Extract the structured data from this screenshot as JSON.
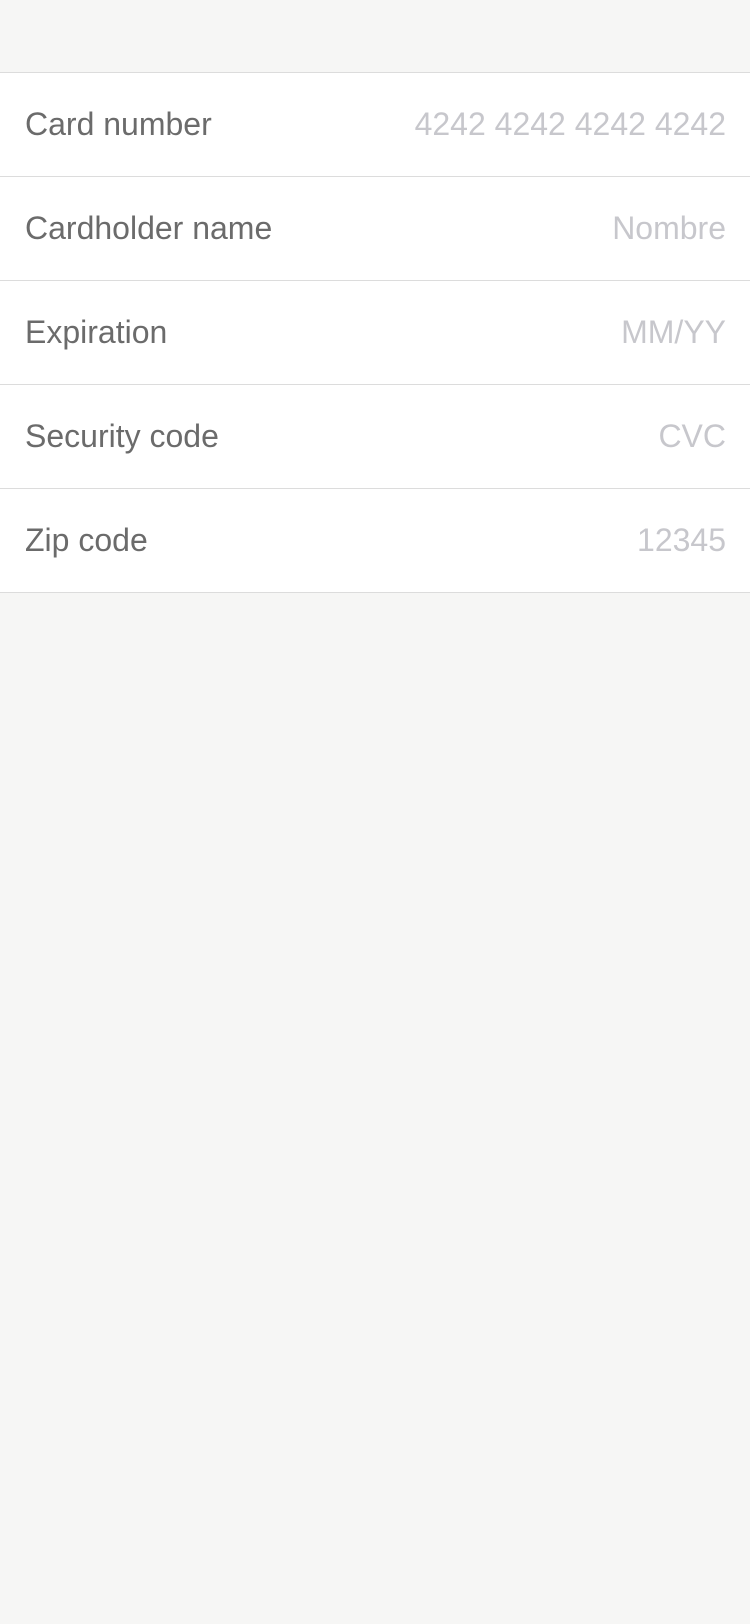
{
  "form": {
    "rows": [
      {
        "label": "Card number",
        "value": "",
        "placeholder": "4242 4242 4242 4242"
      },
      {
        "label": "Cardholder name",
        "value": "",
        "placeholder": "Nombre"
      },
      {
        "label": "Expiration",
        "value": "",
        "placeholder": "MM/YY"
      },
      {
        "label": "Security code",
        "value": "",
        "placeholder": "CVC"
      },
      {
        "label": "Zip code",
        "value": "",
        "placeholder": "12345"
      }
    ]
  },
  "colors": {
    "background": "#f6f6f5",
    "row_background": "#ffffff",
    "separator": "#dcdcdc",
    "label_text": "#6b6b6b",
    "placeholder_text": "#c7c7cc"
  }
}
